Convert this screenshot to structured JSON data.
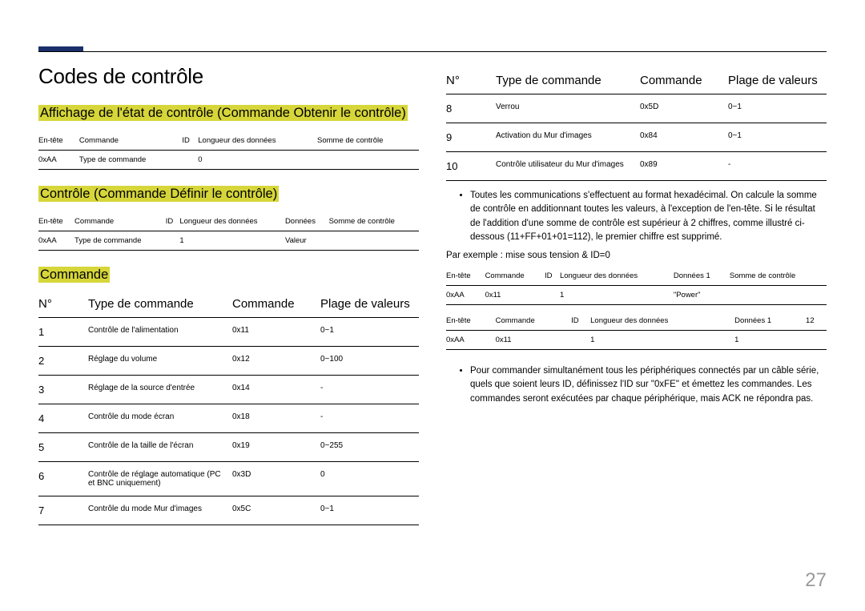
{
  "page_number": "27",
  "title": "Codes de contrôle",
  "left": {
    "section1_heading": "Affichage de l'état de contrôle (Commande Obtenir le contrôle)",
    "table1": {
      "headers": [
        "En-tête",
        "Commande",
        "ID",
        "Longueur des données",
        "Somme de contrôle"
      ],
      "row": [
        "0xAA",
        "Type de commande",
        "",
        "0",
        ""
      ]
    },
    "section2_heading": "Contrôle (Commande Définir le contrôle)",
    "table2": {
      "headers": [
        "En-tête",
        "Commande",
        "ID",
        "Longueur des données",
        "Données",
        "Somme de contrôle"
      ],
      "row": [
        "0xAA",
        "Type de commande",
        "",
        "1",
        "Valeur",
        ""
      ]
    },
    "section3_heading": "Commande",
    "cmd_headers": {
      "no": "N°",
      "type": "Type de commande",
      "cmd": "Commande",
      "range": "Plage de valeurs"
    },
    "commands": [
      {
        "no": "1",
        "type": "Contrôle de l'alimentation",
        "cmd": "0x11",
        "range": "0~1"
      },
      {
        "no": "2",
        "type": "Réglage du volume",
        "cmd": "0x12",
        "range": "0~100"
      },
      {
        "no": "3",
        "type": "Réglage de la source d'entrée",
        "cmd": "0x14",
        "range": "-"
      },
      {
        "no": "4",
        "type": "Contrôle du mode écran",
        "cmd": "0x18",
        "range": "-"
      },
      {
        "no": "5",
        "type": "Contrôle de la taille de l'écran",
        "cmd": "0x19",
        "range": "0~255"
      },
      {
        "no": "6",
        "type": "Contrôle de réglage automatique (PC et BNC uniquement)",
        "cmd": "0x3D",
        "range": "0"
      },
      {
        "no": "7",
        "type": "Contrôle du mode Mur d'images",
        "cmd": "0x5C",
        "range": "0~1"
      }
    ]
  },
  "right": {
    "cmd_headers": {
      "no": "N°",
      "type": "Type de commande",
      "cmd": "Commande",
      "range": "Plage de valeurs"
    },
    "commands": [
      {
        "no": "8",
        "type": "Verrou",
        "cmd": "0x5D",
        "range": "0~1"
      },
      {
        "no": "9",
        "type": "Activation du Mur d'images",
        "cmd": "0x84",
        "range": "0~1"
      },
      {
        "no": "10",
        "type": "Contrôle utilisateur du Mur d'images",
        "cmd": "0x89",
        "range": "-"
      }
    ],
    "bullet1": "Toutes les communications s'effectuent au format hexadécimal. On calcule la somme de contrôle en additionnant toutes les valeurs, à l'exception de l'en-tête. Si le résultat de l'addition d'une somme de contrôle est supérieur à 2 chiffres, comme illustré ci-dessous (11+FF+01+01=112), le premier chiffre est supprimé.",
    "example_line": "Par exemple : mise sous tension & ID=0",
    "tableA": {
      "headers": [
        "En-tête",
        "Commande",
        "ID",
        "Longueur des données",
        "Données 1",
        "Somme de contrôle"
      ],
      "row": [
        "0xAA",
        "0x11",
        "",
        "1",
        "\"Power\"",
        ""
      ]
    },
    "tableB": {
      "headers": [
        "En-tête",
        "Commande",
        "ID",
        "Longueur des données",
        "Données 1",
        "12"
      ],
      "row": [
        "0xAA",
        "0x11",
        "",
        "1",
        "1",
        ""
      ]
    },
    "bullet2": "Pour commander simultanément tous les périphériques connectés par un câble série, quels que soient leurs ID, définissez l'ID sur \"0xFE\" et émettez les commandes. Les commandes seront exécutées par chaque périphérique, mais ACK ne répondra pas."
  }
}
